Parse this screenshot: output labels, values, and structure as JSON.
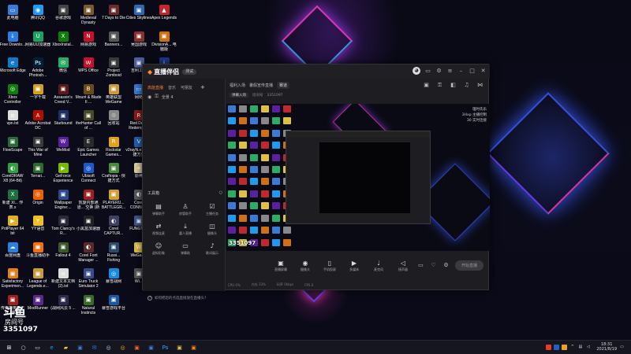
{
  "desktop": {
    "icons": [
      {
        "label": "此电脑",
        "icon": "computer-icon",
        "color": "#3a7bd5",
        "glyph": "▭"
      },
      {
        "label": "腾讯QQ",
        "icon": "qq-icon",
        "color": "#1e9bf0",
        "glyph": "◉"
      },
      {
        "label": "谷歌游戏",
        "icon": "game-icon",
        "color": "#444",
        "glyph": "▣"
      },
      {
        "label": "Medieval Dynasty",
        "icon": "game-icon",
        "color": "#7a5a2a",
        "glyph": "▣"
      },
      {
        "label": "7 Days to Die",
        "icon": "game-icon",
        "color": "#6b2b2b",
        "glyph": "▣"
      },
      {
        "label": "Cities Skylines",
        "icon": "game-icon",
        "color": "#2b6bb0",
        "glyph": "▣"
      },
      {
        "label": "Apex Legends",
        "icon": "apex-icon",
        "color": "#c0282e",
        "glyph": "▲"
      },
      {
        "label": "Free Downlo...",
        "icon": "download-icon",
        "color": "#2b7de0",
        "glyph": "↓"
      },
      {
        "label": "网易UU加速器",
        "icon": "uu-icon",
        "color": "#1aa260",
        "glyph": "U"
      },
      {
        "label": "XboxInstal...",
        "icon": "xbox-icon",
        "color": "#107c10",
        "glyph": "X"
      },
      {
        "label": "网易游戏",
        "icon": "netease-icon",
        "color": "#c8102e",
        "glyph": "N"
      },
      {
        "label": "Banners...",
        "icon": "game-icon",
        "color": "#555",
        "glyph": "▣"
      },
      {
        "label": "吴国游戏",
        "icon": "game-icon",
        "color": "#8a3030",
        "glyph": "▣"
      },
      {
        "label": "DivisionA... 电脑版",
        "icon": "game-icon",
        "color": "#d07010",
        "glyph": "▣"
      },
      {
        "label": "Microsoft Edge",
        "icon": "edge-icon",
        "color": "#0f7ac6",
        "glyph": "e"
      },
      {
        "label": "Adobe Photosh...",
        "icon": "photoshop-icon",
        "color": "#001e36",
        "glyph": "Ps"
      },
      {
        "label": "微信",
        "icon": "wechat-icon",
        "color": "#2aae67",
        "glyph": "✉"
      },
      {
        "label": "WPS Office",
        "icon": "wps-icon",
        "color": "#c8102e",
        "glyph": "W"
      },
      {
        "label": "Project Zomboid",
        "icon": "game-icon",
        "color": "#3a3a3a",
        "glyph": "▣"
      },
      {
        "label": "吉利工具",
        "icon": "tool-icon",
        "color": "#5060a0",
        "glyph": "▣"
      },
      {
        "label": "iGameCen...",
        "icon": "igame-icon",
        "color": "#1b3a8a",
        "glyph": "i"
      },
      {
        "label": "Xbox Controller Companion",
        "icon": "controller-icon",
        "color": "#107c10",
        "glyph": "◎"
      },
      {
        "label": "一字千载",
        "icon": "app-icon",
        "color": "#d0a020",
        "glyph": "▣"
      },
      {
        "label": "Assassin's Creed V...",
        "icon": "game-icon",
        "color": "#5a1a1a",
        "glyph": "▣"
      },
      {
        "label": "Mount & Blade II ...",
        "icon": "game-icon",
        "color": "#6a4a1a",
        "glyph": "B"
      },
      {
        "label": "英雄联盟 WeGame",
        "icon": "game-icon",
        "color": "#c89b3c",
        "glyph": "▣"
      },
      {
        "label": "网络",
        "icon": "network-icon",
        "color": "#3a7bd5",
        "glyph": "▭"
      },
      {
        "label": "QQ游戏",
        "icon": "qqgame-icon",
        "color": "#2090e0",
        "glyph": "◉"
      },
      {
        "label": "vpn.txt",
        "icon": "text-file-icon",
        "color": "#dddddd",
        "glyph": "≡"
      },
      {
        "label": "Adobe Acrobat DC",
        "icon": "acrobat-icon",
        "color": "#b30b00",
        "glyph": "A"
      },
      {
        "label": "Starbound",
        "icon": "game-icon",
        "color": "#203060",
        "glyph": "▣"
      },
      {
        "label": "theHunter Call of ...",
        "icon": "game-icon",
        "color": "#4a4a2a",
        "glyph": "▣"
      },
      {
        "label": "回收站",
        "icon": "recycle-bin-icon",
        "color": "#888",
        "glyph": "♲"
      },
      {
        "label": "Red Dead Redempti...",
        "icon": "game-icon",
        "color": "#8a1a1a",
        "glyph": "R"
      },
      {
        "label": "Google Chrome",
        "icon": "chrome-icon",
        "color": "#dddddd",
        "glyph": "◎"
      },
      {
        "label": "FlowScape",
        "icon": "game-icon",
        "color": "#2a6a3a",
        "glyph": "▣"
      },
      {
        "label": "This War of Mine",
        "icon": "game-icon",
        "color": "#3a3a3a",
        "glyph": "▣"
      },
      {
        "label": "WeMod",
        "icon": "wemod-icon",
        "color": "#5a20a0",
        "glyph": "W"
      },
      {
        "label": "Epic Games Launcher",
        "icon": "epic-icon",
        "color": "#2a2a2a",
        "glyph": "E"
      },
      {
        "label": "Rockstar Games...",
        "icon": "rockstar-icon",
        "color": "#e0a020",
        "glyph": "R"
      },
      {
        "label": "v2rayN.exe -快捷方式",
        "icon": "app-icon",
        "color": "#2060b0",
        "glyph": "V"
      },
      {
        "label": "不死超能群体 模拟器",
        "icon": "game-icon",
        "color": "#704020",
        "glyph": "▣"
      },
      {
        "label": "CorelDRAW X8 (64-Bit)",
        "icon": "coreldraw-icon",
        "color": "#30a040",
        "glyph": "◐"
      },
      {
        "label": "Terrari...",
        "icon": "game-icon",
        "color": "#2a6a2a",
        "glyph": "▣"
      },
      {
        "label": "GeForce Experience",
        "icon": "geforce-icon",
        "color": "#76b900",
        "glyph": "▶"
      },
      {
        "label": "Ubisoft Connect",
        "icon": "ubisoft-icon",
        "color": "#1a5ad0",
        "glyph": "◎"
      },
      {
        "label": "Craftopia - 快捷方式",
        "icon": "game-icon",
        "color": "#4a8a3a",
        "glyph": "▣"
      },
      {
        "label": "原神",
        "icon": "genshin-icon",
        "color": "#e0d0a0",
        "glyph": "✦"
      },
      {
        "label": "Corel PHOTO-P...",
        "icon": "corel-icon",
        "color": "#a02020",
        "glyph": "◐"
      },
      {
        "label": "新建 Xl... 作表.x",
        "icon": "excel-icon",
        "color": "#1d6f42",
        "glyph": "X"
      },
      {
        "label": "Origin",
        "icon": "origin-icon",
        "color": "#f06000",
        "glyph": "◎"
      },
      {
        "label": "Wallpaper Engine:...",
        "icon": "wallpaper-icon",
        "color": "#2a4a8a",
        "glyph": "▣"
      },
      {
        "label": "凯旋内部通道... 交换 (新设)",
        "icon": "app-icon",
        "color": "#a02020",
        "glyph": "▣"
      },
      {
        "label": "PLAYERU... BATTLEGR...",
        "icon": "pubg-icon",
        "color": "#d0a030",
        "glyph": "▣"
      },
      {
        "label": "Corel CONNE...",
        "icon": "corel-icon",
        "color": "#5a5a5a",
        "glyph": "◐"
      },
      {
        "label": "DaysGon... 作表.x",
        "icon": "game-icon",
        "color": "#5a3a2a",
        "glyph": "▣"
      },
      {
        "label": "PotPlayer 64 bit",
        "icon": "potplayer-icon",
        "color": "#e0b020",
        "glyph": "▶"
      },
      {
        "label": "YY语音",
        "icon": "yy-icon",
        "color": "#f0c020",
        "glyph": "Y"
      },
      {
        "label": "Tom Clancy's R...",
        "icon": "game-icon",
        "color": "#2a2a3a",
        "glyph": "▣"
      },
      {
        "label": "小黑盒加速器",
        "icon": "app-icon",
        "color": "#222",
        "glyph": "▣"
      },
      {
        "label": "Corel CAPTUR...",
        "icon": "corel-icon",
        "color": "#404060",
        "glyph": "◐"
      },
      {
        "label": "FUNGTe...",
        "icon": "app-icon",
        "color": "#3a5a8a",
        "glyph": "▣"
      },
      {
        "label": "Steam",
        "icon": "steam-icon",
        "color": "#1b2838",
        "glyph": "◎"
      },
      {
        "label": "百度网盘",
        "icon": "baidu-icon",
        "color": "#2a80e0",
        "glyph": "☁"
      },
      {
        "label": "斗鱼直播助手",
        "icon": "douyu-icon",
        "color": "#f07010",
        "glyph": "▣"
      },
      {
        "label": "Fallout 4",
        "icon": "game-icon",
        "color": "#3a5a2a",
        "glyph": "▣"
      },
      {
        "label": "Corel Font Manager ...",
        "icon": "corel-icon",
        "color": "#5a2a2a",
        "glyph": "◐"
      },
      {
        "label": "Russi... Fishing",
        "icon": "game-icon",
        "color": "#2a4a6a",
        "glyph": "▣"
      },
      {
        "label": "WeGame",
        "icon": "wegame-icon",
        "color": "#e0c040",
        "glyph": "W"
      },
      {
        "label": "雷神",
        "icon": "app-icon",
        "color": "#2060c0",
        "glyph": "▣"
      },
      {
        "label": "Satisfactory Experimen...",
        "icon": "game-icon",
        "color": "#e08020",
        "glyph": "▣"
      },
      {
        "label": "League of Legends.e...",
        "icon": "lol-icon",
        "color": "#c89b3c",
        "glyph": "▣"
      },
      {
        "label": "新建文本文档 (2).txt",
        "icon": "text-file-icon",
        "color": "#dddddd",
        "glyph": "≡"
      },
      {
        "label": "Euro Truck Simulator 2",
        "icon": "game-icon",
        "color": "#3a4a8a",
        "glyph": "▣"
      },
      {
        "label": "暴雪战网",
        "icon": "battlenet-icon",
        "color": "#1a8ae0",
        "glyph": "◎"
      },
      {
        "label": "Wi...",
        "icon": "app-icon",
        "color": "#555",
        "glyph": "▣"
      },
      {
        "label": "腾讯应用中心",
        "icon": "app-icon",
        "color": "#2a6ad0",
        "glyph": "▣"
      },
      {
        "label": "传奇的英雄无双 (游戏)",
        "icon": "game-icon",
        "color": "#a02020",
        "glyph": "▣"
      },
      {
        "label": "ModRunner",
        "icon": "app-icon",
        "color": "#5a2a8a",
        "glyph": "▣"
      },
      {
        "label": "(战网风云 5 ...",
        "icon": "game-icon",
        "color": "#2a2a4a",
        "glyph": "▣"
      },
      {
        "label": "Natural Instincts",
        "icon": "game-icon",
        "color": "#3a6a2a",
        "glyph": "▣"
      },
      {
        "label": "暴雪游戏平台",
        "icon": "app-icon",
        "color": "#1a5aa0",
        "glyph": "▣"
      }
    ]
  },
  "app": {
    "title": "直播伴侣",
    "badge": "测试",
    "left_tabs": [
      "高能直播",
      "音乐",
      "可朋友"
    ],
    "active_tab": 0,
    "scene_row": "全景 4",
    "tools_heading": "工具箱",
    "tools": [
      {
        "label": "弹幕助手",
        "icon": "danmaku-icon",
        "glyph": "▤"
      },
      {
        "label": "房管助手",
        "icon": "user-icon",
        "glyph": "♙"
      },
      {
        "label": "主播任务",
        "icon": "task-icon",
        "glyph": "☑"
      },
      {
        "label": "视频连麦",
        "icon": "link-icon",
        "glyph": "⇄"
      },
      {
        "label": "嘉人直播",
        "icon": "download-icon",
        "glyph": "⤓"
      },
      {
        "label": "摄像头",
        "icon": "camera-icon",
        "glyph": "◫"
      },
      {
        "label": "虚拟形象",
        "icon": "avatar-icon",
        "glyph": "☺"
      },
      {
        "label": "弹幕助",
        "icon": "chat-icon",
        "glyph": "▭"
      },
      {
        "label": "歌词展示",
        "icon": "lyrics-icon",
        "glyph": "♪"
      }
    ],
    "footer_tip": "如何把您的点选直接放在直播头?",
    "top_bar": [
      "福利入场",
      "暑假宣传直播",
      "赛道"
    ],
    "room": {
      "chip": "弹幕入场",
      "id_label": "房间号",
      "id": "3351097"
    },
    "preview_text": [
      "理时氏乐",
      "3Hxp 主播控制",
      "30 实时连接"
    ],
    "preview_watermark": "3351097",
    "controls": [
      {
        "label": "直播屏幕",
        "icon": "screen-share-icon",
        "glyph": "▣"
      },
      {
        "label": "摄像头",
        "icon": "camera-icon",
        "glyph": "◉"
      },
      {
        "label": "手机投屏",
        "icon": "phone-icon",
        "glyph": "▯"
      },
      {
        "label": "多媒体",
        "icon": "media-icon",
        "glyph": "▶"
      },
      {
        "label": "麦克风",
        "icon": "microphone-icon",
        "glyph": "♩"
      },
      {
        "label": "扬声器",
        "icon": "speaker-icon",
        "glyph": "◁"
      }
    ],
    "go_live_label": "开始直播",
    "status": [
      "CPU 0%",
      "内存 33%",
      "码率 0kbps",
      "FPS 0"
    ]
  },
  "overlay": {
    "logo": "斗鱼",
    "label": "房间号",
    "number": "3351097"
  },
  "taskbar": {
    "apps": [
      {
        "icon": "start-icon",
        "glyph": "⊞",
        "color": "#ffffff"
      },
      {
        "icon": "search-icon",
        "glyph": "○",
        "color": "#dddddd"
      },
      {
        "icon": "task-view-icon",
        "glyph": "▭",
        "color": "#dddddd"
      },
      {
        "icon": "edge-icon",
        "glyph": "e",
        "color": "#1e9bf0"
      },
      {
        "icon": "file-explorer-icon",
        "glyph": "▰",
        "color": "#f0c040"
      },
      {
        "icon": "store-icon",
        "glyph": "▣",
        "color": "#3a7bd5"
      },
      {
        "icon": "mail-icon",
        "glyph": "✉",
        "color": "#2a80e0"
      },
      {
        "icon": "steam-icon",
        "glyph": "◎",
        "color": "#aaccee"
      },
      {
        "icon": "chrome-icon",
        "glyph": "◎",
        "color": "#f0b020"
      },
      {
        "icon": "app-icon",
        "glyph": "▣",
        "color": "#f06020"
      },
      {
        "icon": "app-icon",
        "glyph": "▣",
        "color": "#3a7bd5"
      },
      {
        "icon": "photoshop-icon",
        "glyph": "Ps",
        "color": "#31a8ff"
      },
      {
        "icon": "app-icon",
        "glyph": "▣",
        "color": "#e0c040"
      },
      {
        "icon": "live-companion-icon",
        "glyph": "▣",
        "color": "#f08020"
      }
    ],
    "time": "18:31",
    "date": "2021/8/19"
  }
}
